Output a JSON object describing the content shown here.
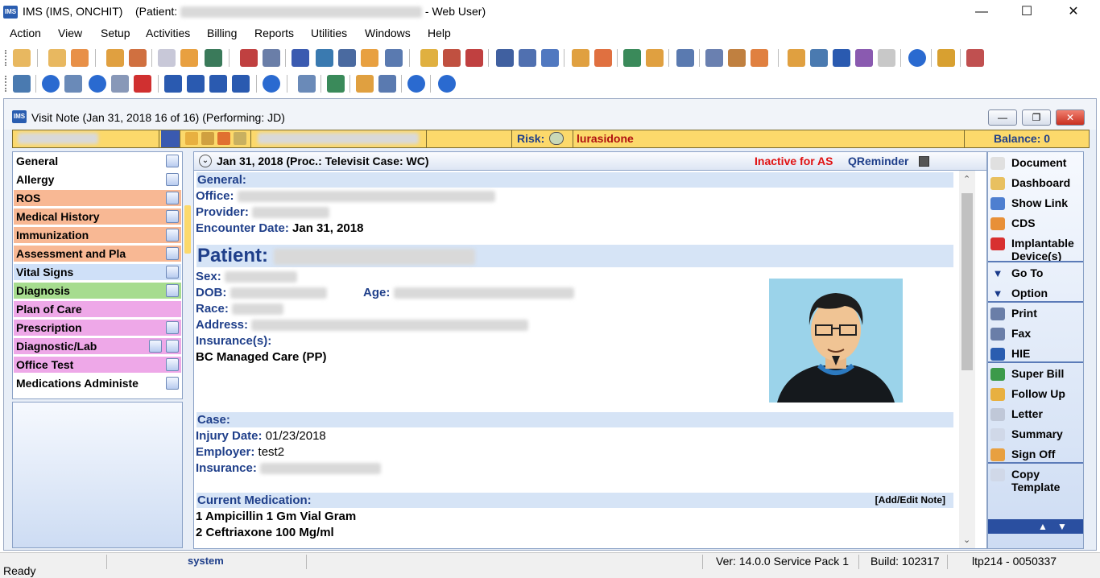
{
  "window": {
    "title_prefix": "IMS (IMS, ONCHIT)",
    "patient_label": "(Patient:",
    "title_suffix": "- Web User)",
    "app_icon_text": "IMS",
    "controls": {
      "minimize": "—",
      "maximize": "☐",
      "close": "✕"
    }
  },
  "menu": [
    "Action",
    "View",
    "Setup",
    "Activities",
    "Billing",
    "Reports",
    "Utilities",
    "Windows",
    "Help"
  ],
  "visit_window": {
    "title": "Visit Note (Jan 31, 2018   16 of 16) (Performing: JD)",
    "icon_text": "IMS"
  },
  "patient_strip": {
    "risk_label": "Risk:",
    "drug": "lurasidone",
    "balance": "Balance: 0"
  },
  "left_nav": [
    {
      "label": "General",
      "color": "#ffffff",
      "icon": true
    },
    {
      "label": "Allergy",
      "color": "#ffffff",
      "icon": true
    },
    {
      "label": "ROS",
      "color": "#f8b894",
      "icon": true
    },
    {
      "label": "Medical History",
      "color": "#f8b894",
      "icon": true
    },
    {
      "label": "Immunization",
      "color": "#f8b894",
      "icon": true
    },
    {
      "label": "Assessment and Pla",
      "color": "#f8b894",
      "icon": true
    },
    {
      "label": "Vital Signs",
      "color": "#cfe0f8",
      "icon": true
    },
    {
      "label": "Diagnosis",
      "color": "#a6dc8f",
      "icon": true
    },
    {
      "label": "Plan of Care",
      "color": "#eea8e8",
      "icon": false
    },
    {
      "label": "Prescription",
      "color": "#eea8e8",
      "icon": true
    },
    {
      "label": "Diagnostic/Lab",
      "color": "#eea8e8",
      "icon": true,
      "icon2": true
    },
    {
      "label": "Office Test",
      "color": "#eea8e8",
      "icon": true
    },
    {
      "label": "Medications Administe",
      "color": "#ffffff",
      "icon": true
    }
  ],
  "note": {
    "header_date": "Jan 31, 2018  (Proc.: Televisit  Case: WC)",
    "inactive": "Inactive for AS",
    "qreminder": "QReminder",
    "general_title": "General:",
    "office_label": "Office:",
    "provider_label": "Provider:",
    "encounter_label": "Encounter Date:",
    "encounter_value": "Jan 31, 2018",
    "patient_title": "Patient:",
    "sex_label": "Sex:",
    "dob_label": "DOB:",
    "age_label": "Age:",
    "race_label": "Race:",
    "address_label": "Address:",
    "insurance_label": "Insurance(s):",
    "insurance_value": "BC Managed Care (PP)",
    "case_title": "Case:",
    "injury_label": "Injury Date:",
    "injury_value": "01/23/2018",
    "employer_label": "Employer:",
    "employer_value": "test2",
    "case_insurance_label": "Insurance:",
    "medication_title": "Current Medication:",
    "add_edit_note": "[Add/Edit Note]",
    "medications": [
      "1 Ampicillin 1 Gm Vial Gram",
      "2 Ceftriaxone 100 Mg/ml"
    ]
  },
  "right_panel": [
    {
      "label": "Document",
      "icon": "document-icon",
      "color": "#e0e0e0"
    },
    {
      "label": "Dashboard",
      "icon": "dashboard-icon",
      "color": "#e8c060"
    },
    {
      "label": "Show Link",
      "icon": "link-icon",
      "color": "#4e7fd0"
    },
    {
      "label": "CDS",
      "icon": "cds-icon",
      "color": "#e89038"
    },
    {
      "label": "Implantable Device(s)",
      "icon": "heart-icon",
      "color": "#d83030"
    },
    {
      "label": "Go To",
      "icon": "triangle-down-icon",
      "color": "#1a3a8a"
    },
    {
      "label": "Option",
      "icon": "triangle-down-icon",
      "color": "#1a3a8a"
    },
    {
      "label": "Print",
      "icon": "printer-icon",
      "color": "#6a7ea8"
    },
    {
      "label": "Fax",
      "icon": "fax-icon",
      "color": "#6a7ea8"
    },
    {
      "label": "HIE",
      "icon": "hie-icon",
      "color": "#2a5db0"
    },
    {
      "label": "Super Bill",
      "icon": "superbill-icon",
      "color": "#3c9a4a"
    },
    {
      "label": "Follow Up",
      "icon": "calendar-icon",
      "color": "#e8b040"
    },
    {
      "label": "Letter",
      "icon": "letter-icon",
      "color": "#c0c8d8"
    },
    {
      "label": "Summary",
      "icon": "summary-icon",
      "color": "#d0d8e8"
    },
    {
      "label": "Sign Off",
      "icon": "signoff-icon",
      "color": "#e8a040"
    },
    {
      "label": "Copy Template",
      "icon": "copy-icon",
      "color": "#d0d8e8"
    }
  ],
  "status_bar": {
    "left": "Ready",
    "user": "system",
    "version": "Ver: 14.0.0 Service Pack 1",
    "build": "Build: 102317",
    "machine": "ltp214 - 0050337"
  }
}
